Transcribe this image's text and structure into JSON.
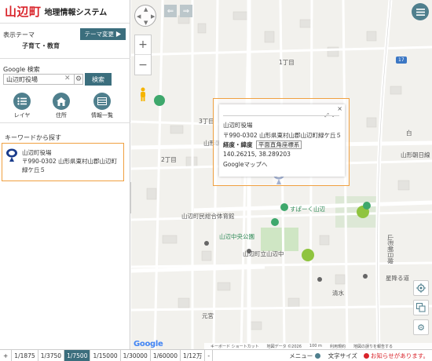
{
  "header": {
    "logo": "山辺町",
    "subtitle": "地理情報システム"
  },
  "theme": {
    "label": "表示テーマ",
    "change_button": "テーマ変更 ▶",
    "value": "子育て・教育"
  },
  "google_search": {
    "label": "Google 検索",
    "value": "山辺町役場",
    "button": "検索"
  },
  "nav": [
    {
      "label": "レイヤ"
    },
    {
      "label": "住所"
    },
    {
      "label": "情報一覧"
    }
  ],
  "keyword": {
    "label": "キーワードから探す"
  },
  "result": {
    "name": "山辺町役場",
    "address": "〒990-0302 山形県東村山郡山辺町緑ケ丘５"
  },
  "popup": {
    "name": "山辺町役場",
    "address": "〒990-0302 山形県東村山郡山辺町緑ケ丘５",
    "latlon_tab": "経度・緯度",
    "plane_tab": "平面直角座標系",
    "coords": "140.26215, 38.289203",
    "gmaps_link": "Googleマップへ",
    "close": "×"
  },
  "map_labels": {
    "area1": "1丁目",
    "area2": "2丁目",
    "area3": "3丁目",
    "yamagata_asahi_line": "山形朝日線",
    "yamagata_asahi_line2": "山形朝日線",
    "shiratsuki": "白",
    "yamanobe_hall": "山辺町民総合体育館",
    "sugoku": "すぱーく山辺",
    "chuo_park": "山辺中央公園",
    "yamanobe_jhs": "山辺町立山辺中",
    "hoshi": "星降る道",
    "shimizu": "清水",
    "motomiya": "元宮",
    "yamagata_route": "山形朝日線",
    "route_num": "17"
  },
  "attribution": {
    "keyboard": "キーボード ショートカット",
    "mapdata": "地図データ ©2026",
    "scale": "100 m",
    "terms": "利用規約",
    "report": "地図の誤りを報告する"
  },
  "google": "Google",
  "scales": [
    "+",
    "1/1875",
    "1/3750",
    "1/7500",
    "1/15000",
    "1/30000",
    "1/60000",
    "1/12万",
    "-"
  ],
  "bottom_right": {
    "menu": "メニュー",
    "text_size": "文字サイズ",
    "notice": "お知らせがあります。"
  }
}
